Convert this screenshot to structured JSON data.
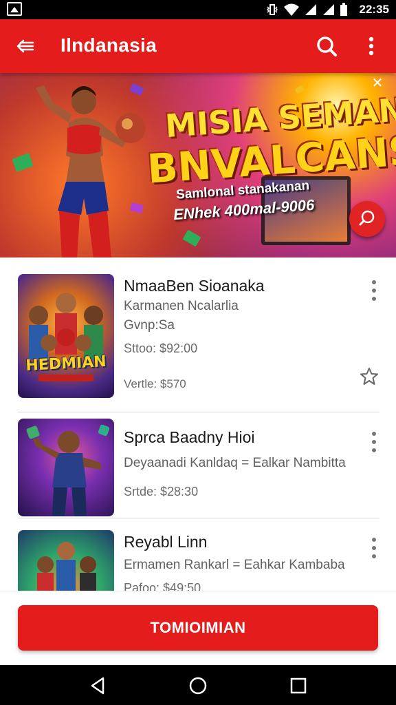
{
  "status_bar": {
    "time": "22:35"
  },
  "app_bar": {
    "title": "Ilndanasia"
  },
  "banner": {
    "headline_line1": "MISIA SEMAN",
    "headline_line2": "BNVALCANS",
    "subtitle_line1": "Samlonal stanakanan",
    "subtitle_line2": "ENhek 400mal-9006"
  },
  "items": [
    {
      "name": "NmaaBen Sioanaka",
      "line1": "Karmanen Ncalarlia",
      "line2": "Gvnp:Sa",
      "price": "Sttoo: $92:00",
      "extra": "Vertle: $570",
      "thumb_caption": "HEDMIAN"
    },
    {
      "name": "Sprca Baadny Hioi",
      "line1": "Deyaanadi Kanldaq = Ealkar Nambitta",
      "price": "Srtde: $28:30"
    },
    {
      "name": "Reyabl Linn",
      "line1": "Ermamen Rankarl = Eahkar Kambaba",
      "price": "Pafoo: $49:50"
    }
  ],
  "cta_label": "TOMIOIMIAN",
  "colors": {
    "brand_red": "#e41c1c",
    "star_outline": "#666666"
  }
}
